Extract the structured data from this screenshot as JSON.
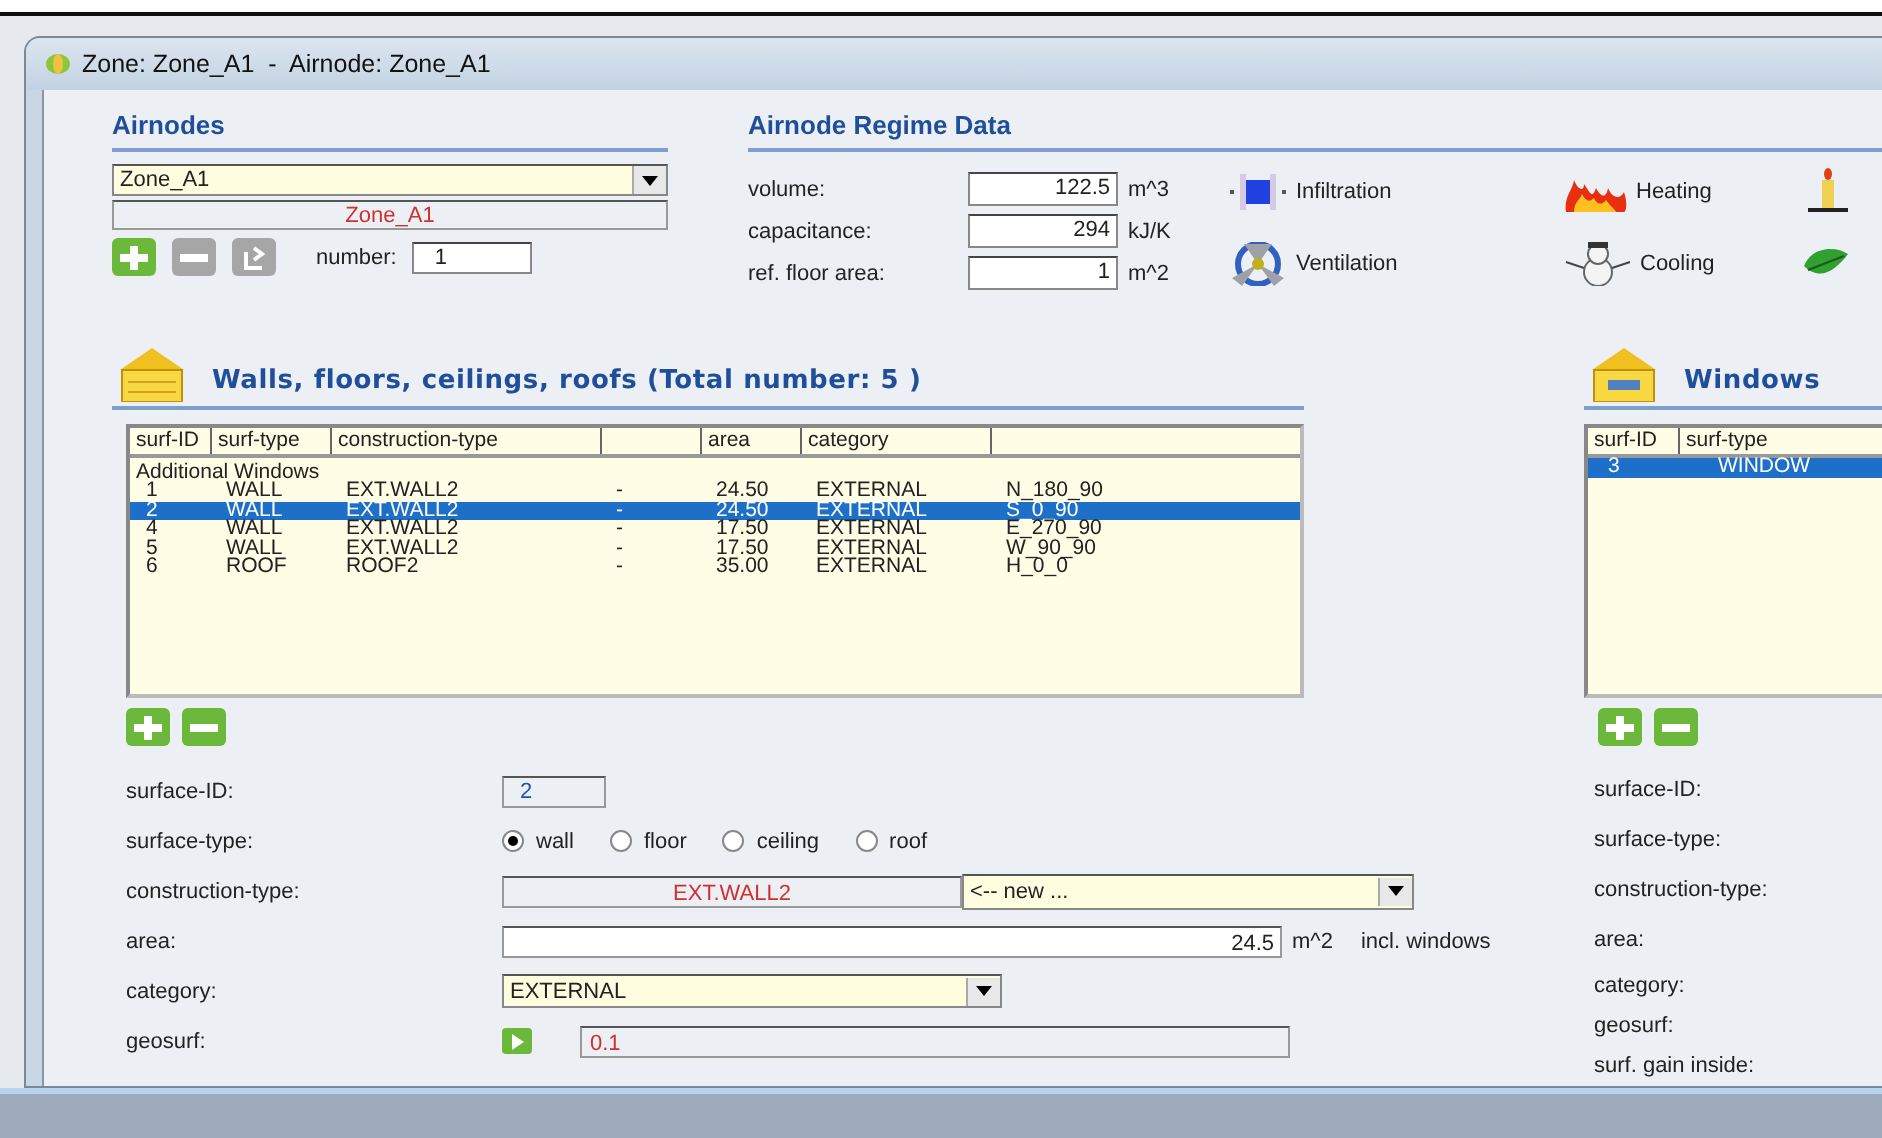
{
  "window": {
    "title": "Zone: Zone_A1  -  Airnode: Zone_A1"
  },
  "airnodes": {
    "heading": "Airnodes",
    "selector_value": "Zone_A1",
    "name_display": "Zone_A1",
    "number_label": "number:",
    "number_value": "1",
    "buttons": [
      {
        "kind": "add",
        "disabled": false
      },
      {
        "kind": "remove",
        "disabled": true
      },
      {
        "kind": "reload",
        "disabled": true
      }
    ]
  },
  "regime": {
    "heading": "Airnode Regime Data",
    "fields": [
      {
        "label": "volume:",
        "value": "122.5",
        "unit": "m^3"
      },
      {
        "label": "capacitance:",
        "value": "294",
        "unit": "kJ/K"
      },
      {
        "label": "ref. floor area:",
        "value": "1",
        "unit": "m^2"
      }
    ],
    "items": [
      {
        "kind": "infiltration",
        "label": "Infiltration"
      },
      {
        "kind": "heating",
        "label": "Heating"
      },
      {
        "kind": "lamp"
      },
      {
        "kind": "ventilation",
        "label": "Ventilation"
      },
      {
        "kind": "cooling",
        "label": "Cooling"
      },
      {
        "kind": "plant"
      }
    ]
  },
  "walls": {
    "heading": "Walls, floors, ceilings, roofs (Total number: 5 )",
    "columns": [
      {
        "label": "surf-ID"
      },
      {
        "label": "surf-type"
      },
      {
        "label": "construction-type"
      },
      {},
      {
        "label": "area"
      },
      {
        "label": "category"
      },
      {}
    ],
    "group_label": "Additional Windows",
    "rows": [
      {
        "cells": [
          "1",
          "WALL",
          "EXT.WALL2",
          "-",
          "24.50",
          "EXTERNAL",
          "N_180_90"
        ],
        "selected": false
      },
      {
        "cells": [
          "2",
          "WALL",
          "EXT.WALL2",
          "-",
          "24.50",
          "EXTERNAL",
          "S_0_90"
        ],
        "selected": true
      },
      {
        "cells": [
          "4",
          "WALL",
          "EXT.WALL2",
          "-",
          "17.50",
          "EXTERNAL",
          "E_270_90"
        ],
        "selected": false
      },
      {
        "cells": [
          "5",
          "WALL",
          "EXT.WALL2",
          "-",
          "17.50",
          "EXTERNAL",
          "W_90_90"
        ],
        "selected": false
      },
      {
        "cells": [
          "6",
          "ROOF",
          "ROOF2",
          "-",
          "35.00",
          "EXTERNAL",
          "H_0_0"
        ],
        "selected": false
      }
    ],
    "buttons": [
      {
        "kind": "add",
        "disabled": false
      },
      {
        "kind": "remove",
        "disabled": false
      }
    ]
  },
  "form": [
    {
      "kind": "id",
      "label": "surface-ID:",
      "value": "2"
    },
    {
      "kind": "radio",
      "label": "surface-type:",
      "options": [
        {
          "label": "wall",
          "selected": true
        },
        {
          "label": "floor",
          "selected": false
        },
        {
          "label": "ceiling",
          "selected": false
        },
        {
          "label": "roof",
          "selected": false
        }
      ]
    },
    {
      "kind": "construction",
      "label": "construction-type:",
      "value": "EXT.WALL2",
      "choice": "<-- new ..."
    },
    {
      "kind": "area",
      "label": "area:",
      "value": "24.5",
      "unit": "m^2",
      "note": "incl. windows"
    },
    {
      "kind": "select",
      "label": "category:",
      "value": "EXTERNAL"
    },
    {
      "kind": "geosurf",
      "label": "geosurf:",
      "value": "0.1"
    }
  ],
  "windows": {
    "heading": "Windows",
    "columns": [
      {
        "label": "surf-ID"
      },
      {
        "label": "surf-type"
      }
    ],
    "rows": [
      {
        "cells": [
          "3",
          "WINDOW"
        ],
        "selected": true
      }
    ],
    "buttons": [
      {
        "kind": "add",
        "disabled": false
      },
      {
        "kind": "remove",
        "disabled": false
      }
    ],
    "labels": [
      "surface-ID:",
      "surface-type:",
      "construction-type:",
      "area:",
      "category:",
      "geosurf:",
      "surf. gain inside:"
    ]
  }
}
